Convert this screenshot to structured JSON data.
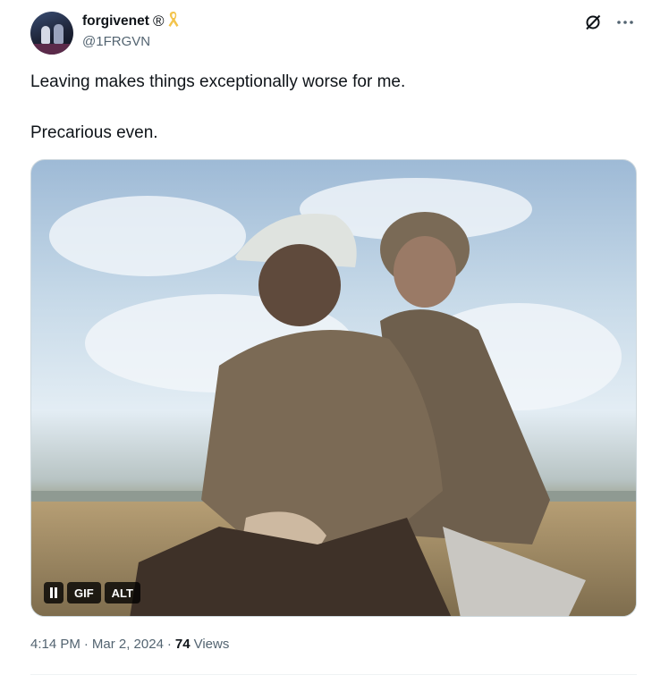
{
  "author": {
    "display_name": "forgivenet",
    "registered_mark": "®",
    "handle": "@1FRGVN",
    "badge_icon": "awareness-ribbon-icon",
    "badge_color": "#f3c44c"
  },
  "tweet": {
    "lines": [
      "Leaving makes things exceptionally worse for me.",
      "Precarious even."
    ]
  },
  "media": {
    "type": "gif",
    "controls": {
      "pause_icon": "pause-icon",
      "gif_label": "GIF",
      "alt_label": "ALT"
    }
  },
  "meta": {
    "time": "4:14 PM",
    "separator": "·",
    "date": "Mar 2, 2024",
    "views_count": "74",
    "views_label": "Views"
  },
  "icons": {
    "grok": "grok-slash-icon",
    "more": "more-dots-icon"
  },
  "colors": {
    "text_primary": "#0f1419",
    "text_secondary": "#536471",
    "border": "#cfd9de"
  }
}
